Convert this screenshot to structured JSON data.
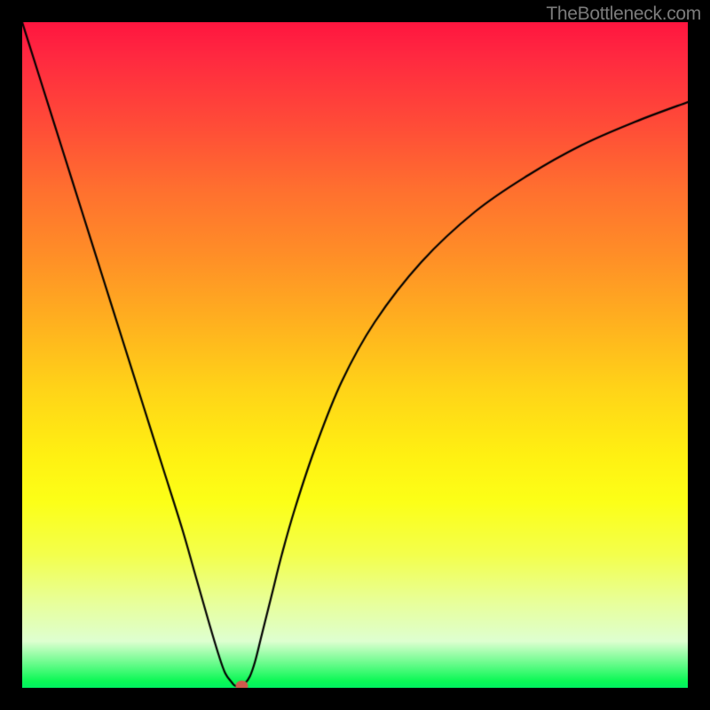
{
  "watermark": "TheBottleneck.com",
  "chart_data": {
    "type": "line",
    "title": "",
    "xlabel": "",
    "ylabel": "",
    "x_range": [
      0,
      100
    ],
    "y_range": [
      0,
      100
    ],
    "series": [
      {
        "name": "bottleneck-curve",
        "x": [
          0,
          3,
          6,
          9,
          12,
          15,
          18,
          21,
          24,
          26,
          28,
          29.5,
          30.5,
          31.5,
          32,
          32.7,
          33.4,
          34.2,
          35,
          36,
          37.5,
          39,
          41,
          44,
          48,
          53,
          60,
          68,
          76,
          84,
          92,
          100
        ],
        "values": [
          100,
          90.5,
          81,
          71.5,
          62,
          52.5,
          43,
          33.5,
          24,
          17,
          10,
          5,
          2.2,
          0.8,
          0.3,
          0.3,
          0.6,
          1.7,
          4,
          8,
          14,
          20,
          27,
          36,
          46,
          55,
          64,
          71.5,
          77,
          81.5,
          85,
          88
        ]
      }
    ],
    "marker": {
      "x": 33,
      "y": 0.3,
      "color": "#cf5a4c"
    },
    "gradient_bands": [
      {
        "stop": 0,
        "color": "#ff153f"
      },
      {
        "stop": 50,
        "color": "#ffd318"
      },
      {
        "stop": 80,
        "color": "#f3ff4c"
      },
      {
        "stop": 100,
        "color": "#00f060"
      }
    ]
  }
}
